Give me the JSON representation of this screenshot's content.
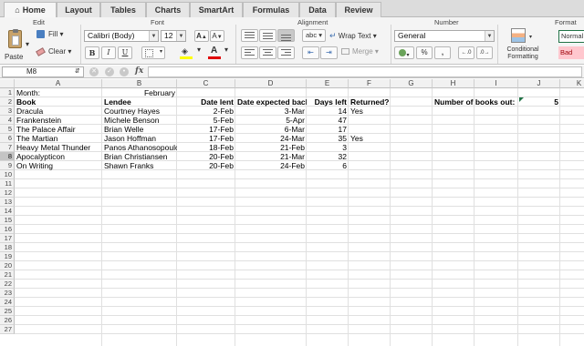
{
  "tabs": [
    {
      "label": "Home",
      "active": true
    },
    {
      "label": "Layout"
    },
    {
      "label": "Tables"
    },
    {
      "label": "Charts"
    },
    {
      "label": "SmartArt"
    },
    {
      "label": "Formulas"
    },
    {
      "label": "Data"
    },
    {
      "label": "Review"
    }
  ],
  "ribbon": {
    "groups": {
      "edit": "Edit",
      "font": "Font",
      "alignment": "Alignment",
      "number": "Number",
      "format": "Format"
    },
    "paste": "Paste",
    "fill": "Fill",
    "clear": "Clear",
    "font_name": "Calibri (Body)",
    "font_size": "12",
    "bold": "B",
    "italic": "I",
    "underline": "U",
    "grow_font": "A",
    "shrink_font": "A",
    "wrap_text": "Wrap Text",
    "wrap_abc": "abc",
    "merge": "Merge",
    "number_format": "General",
    "percent": "%",
    "comma": ",",
    "conditional_formatting": "Conditional Formatting",
    "style_normal": "Normal",
    "style_bad": "Bad",
    "colors": {
      "accent": "#217346",
      "fill_swatch": "#ffff00",
      "font_swatch": "#e00000",
      "bad_fill": "#ffc7ce",
      "bad_text": "#9c0006"
    }
  },
  "formula_bar": {
    "name_box": "M8",
    "fx": "fx",
    "content": ""
  },
  "grid": {
    "columns": [
      "A",
      "B",
      "C",
      "D",
      "E",
      "F",
      "G",
      "H",
      "I",
      "J",
      "K"
    ],
    "row_numbers": [
      "1",
      "2",
      "3",
      "4",
      "5",
      "6",
      "7",
      "8",
      "9",
      "10",
      "11",
      "12",
      "13",
      "14",
      "15",
      "16",
      "17",
      "18",
      "19",
      "20",
      "21",
      "22",
      "23",
      "24",
      "25",
      "26",
      "27"
    ],
    "selected_row": "8",
    "rows": {
      "1": {
        "A": "Month:",
        "B": "February"
      },
      "2": {
        "A": "Book",
        "B": "Lendee",
        "C": "Date lent",
        "D": "Date expected back",
        "E": "Days left",
        "F": "Returned?",
        "H": "Number of books out:",
        "J": "5"
      },
      "3": {
        "A": "Dracula",
        "B": "Courtney Hayes",
        "C": "2-Feb",
        "D": "3-Mar",
        "E": "14",
        "F": "Yes"
      },
      "4": {
        "A": "Frankenstein",
        "B": "Michele Benson",
        "C": "5-Feb",
        "D": "5-Apr",
        "E": "47"
      },
      "5": {
        "A": "The Palace Affair",
        "B": "Brian Welle",
        "C": "17-Feb",
        "D": "6-Mar",
        "E": "17"
      },
      "6": {
        "A": "The Martian",
        "B": "Jason Hoffman",
        "C": "17-Feb",
        "D": "24-Mar",
        "E": "35",
        "F": "Yes"
      },
      "7": {
        "A": "Heavy Metal Thunder",
        "B": "Panos Athanosopoulos",
        "C": "18-Feb",
        "D": "21-Feb",
        "E": "3"
      },
      "8": {
        "A": "Apocalypticon",
        "B": "Brian Christiansen",
        "C": "20-Feb",
        "D": "21-Mar",
        "E": "32"
      },
      "9": {
        "A": "On Writing",
        "B": "Shawn Franks",
        "C": "20-Feb",
        "D": "24-Feb",
        "E": "6"
      }
    }
  }
}
